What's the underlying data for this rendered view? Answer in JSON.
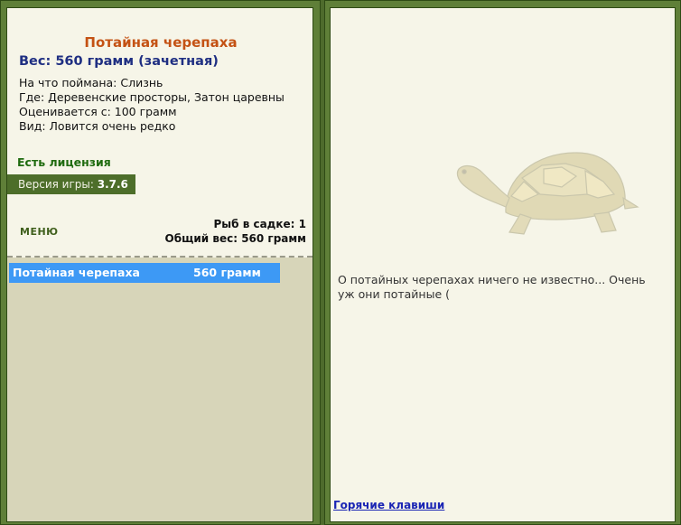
{
  "fish": {
    "title": "Потайная черепаха",
    "weight_line": "Вес: 560 грамм (зачетная)",
    "bait_line": "На что поймана: Слизнь",
    "location_line": "Где: Деревенские просторы, Затон царевны",
    "rated_from_line": "Оценивается с: 100 грамм",
    "rarity_line": "Вид: Ловится очень редко"
  },
  "license": {
    "label": "Есть лицензия"
  },
  "version": {
    "label": "Версия игры:",
    "value": "3.7.6"
  },
  "menu": {
    "label": "МЕНЮ"
  },
  "stats": {
    "fish_count_line": "Рыб в садке: 1",
    "total_weight_line": "Общий вес: 560 грамм"
  },
  "catch_list": [
    {
      "name": "Потайная черепаха",
      "weight": "560 грамм",
      "selected": true
    }
  ],
  "right_panel": {
    "image_icon": "turtle-illustration",
    "description": "О потайных черепахах ничего не известно... Очень уж они потайные (",
    "hotkeys_link": "Горячие клавиши"
  },
  "colors": {
    "frame_green": "#5f7f38",
    "panel_background": "#f6f5e8",
    "catch_area_background": "#d7d5b9",
    "selected_row": "#3d99f5",
    "title_orange": "#c45214",
    "weight_blue": "#1f2f82",
    "license_green": "#1f6b0f",
    "link_blue": "#1a25b4"
  }
}
